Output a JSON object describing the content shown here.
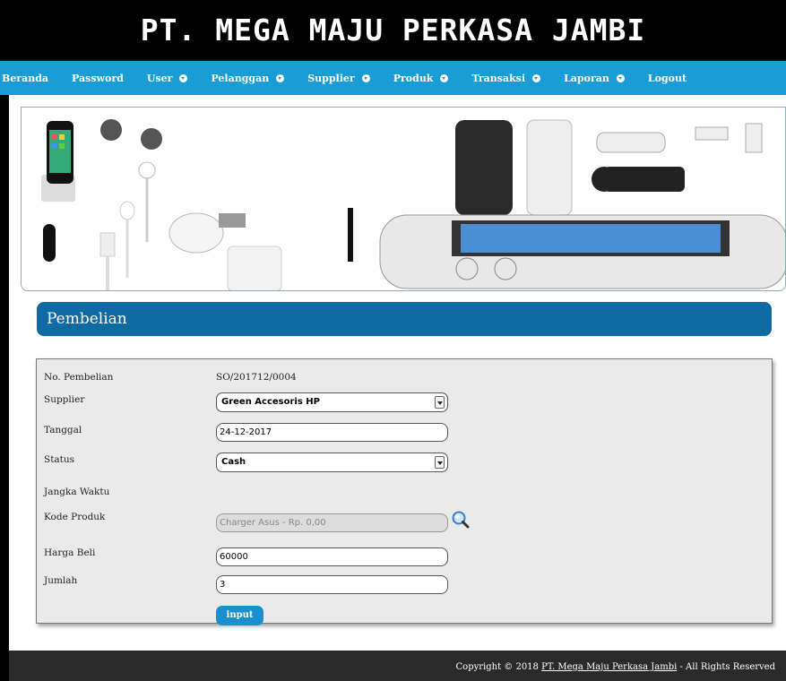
{
  "header": {
    "title": "PT. MEGA MAJU PERKASA JAMBI"
  },
  "nav": [
    {
      "label": "Beranda",
      "dropdown": false
    },
    {
      "label": "Password",
      "dropdown": false
    },
    {
      "label": "User",
      "dropdown": true
    },
    {
      "label": "Pelanggan",
      "dropdown": true
    },
    {
      "label": "Supplier",
      "dropdown": true
    },
    {
      "label": "Produk",
      "dropdown": true
    },
    {
      "label": "Transaksi",
      "dropdown": true
    },
    {
      "label": "Laporan",
      "dropdown": true
    },
    {
      "label": "Logout",
      "dropdown": false
    }
  ],
  "section": {
    "title": "Pembelian"
  },
  "form": {
    "no_pembelian": {
      "label": "No. Pembelian",
      "value": "SO/201712/0004"
    },
    "supplier": {
      "label": "Supplier",
      "value": "Green Accesoris HP"
    },
    "tanggal": {
      "label": "Tanggal",
      "value": "24-12-2017"
    },
    "status": {
      "label": "Status",
      "value": "Cash"
    },
    "jangka_waktu": {
      "label": "Jangka Waktu"
    },
    "kode_produk": {
      "label": "Kode Produk",
      "placeholder": "Charger Asus - Rp. 0,00"
    },
    "harga_beli": {
      "label": "Harga Beli",
      "value": "60000"
    },
    "jumlah": {
      "label": "Jumlah",
      "value": "3"
    },
    "submit_label": "input"
  },
  "footer": {
    "prefix": "Copyright © 2018 ",
    "link": "PT. Mega Maju Perkasa Jambi",
    "suffix": " - All Rights Reserved"
  },
  "icons": {
    "search": "magnifier-icon",
    "dropdown": "chevron-down-icon"
  },
  "colors": {
    "nav": "#1a9dd4",
    "section_bar": "#0f6aa3",
    "button": "#1a8fd0"
  }
}
